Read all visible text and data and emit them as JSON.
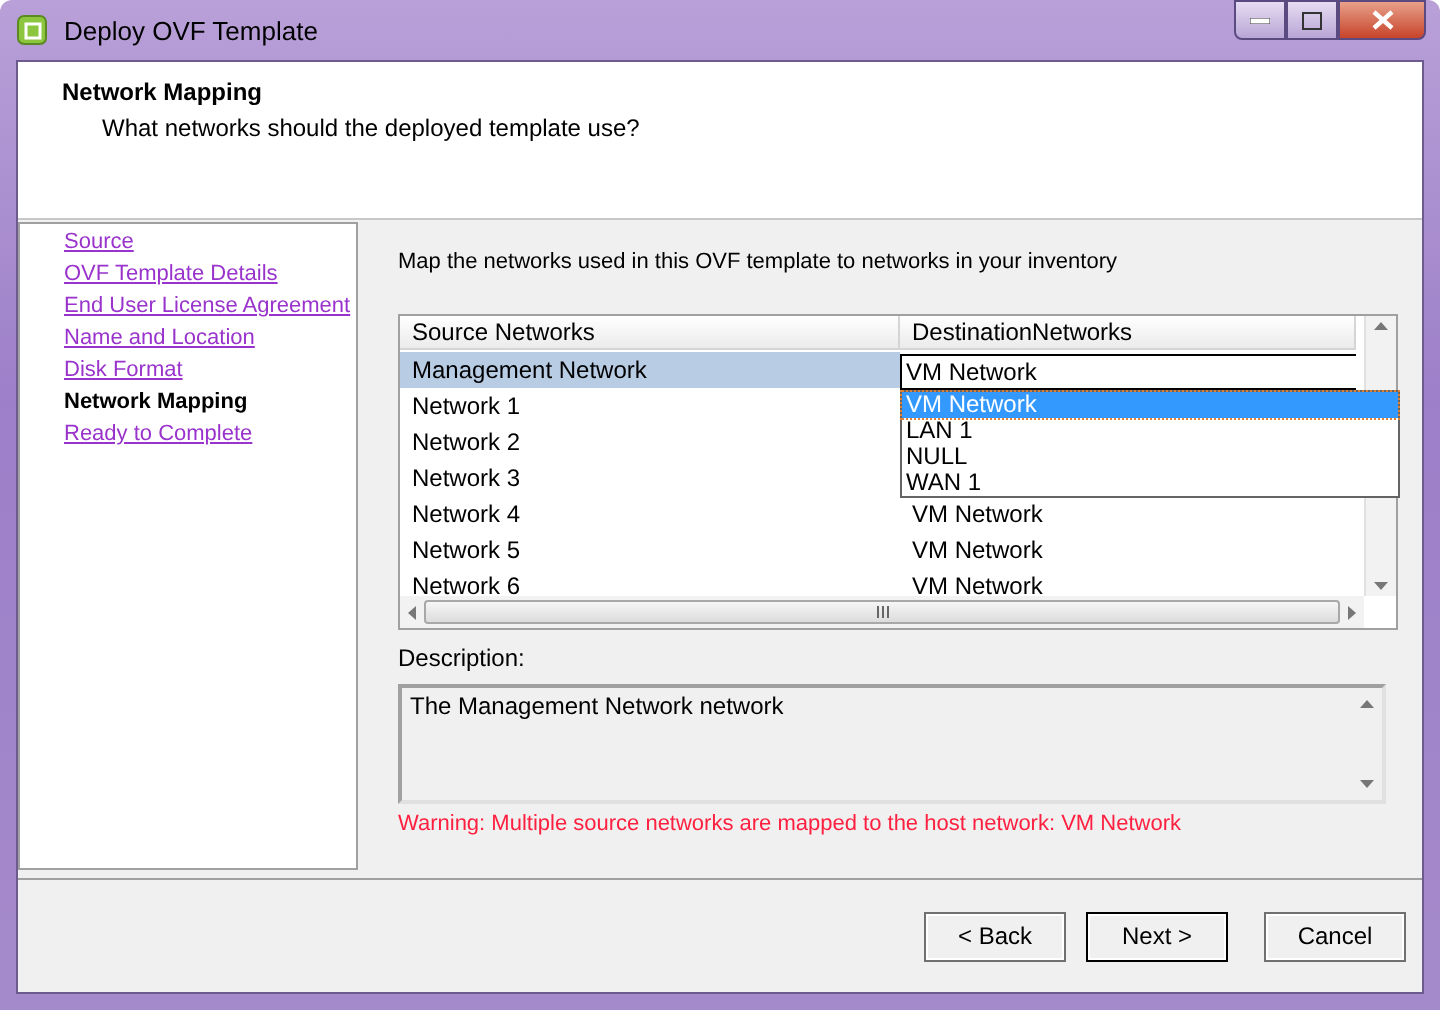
{
  "window": {
    "title": "Deploy OVF Template"
  },
  "header": {
    "title": "Network Mapping",
    "subtitle": "What networks should the deployed template use?"
  },
  "steps": [
    {
      "label": "Source",
      "selected": false
    },
    {
      "label": "OVF Template Details",
      "selected": false
    },
    {
      "label": "End User License Agreement",
      "selected": false
    },
    {
      "label": "Name and Location",
      "selected": false
    },
    {
      "label": "Disk Format",
      "selected": false
    },
    {
      "label": "Network Mapping",
      "selected": true
    },
    {
      "label": "Ready to Complete",
      "selected": false
    }
  ],
  "intro": "Map the networks used in this OVF template to networks in your inventory",
  "table": {
    "columns": [
      "Source Networks",
      "DestinationNetworks"
    ],
    "rows": [
      {
        "source": "Management Network",
        "destination": "VM Network",
        "selected": true
      },
      {
        "source": "Network 1",
        "selected": false
      },
      {
        "source": "Network 2",
        "selected": false
      },
      {
        "source": "Network 3",
        "selected": false
      },
      {
        "source": "Network 4",
        "destination": "VM Network",
        "selected": false
      },
      {
        "source": "Network 5",
        "destination": "VM Network",
        "selected": false
      },
      {
        "source": "Network 6",
        "destination": "VM Network",
        "selected": false
      }
    ],
    "dropdown": {
      "options": [
        {
          "label": "VM Network",
          "selected": true
        },
        {
          "label": "LAN 1",
          "selected": false
        },
        {
          "label": "NULL",
          "selected": false
        },
        {
          "label": "WAN 1",
          "selected": false
        }
      ]
    }
  },
  "description": {
    "label": "Description:",
    "text": "The Management Network network"
  },
  "warning": "Warning: Multiple source networks are mapped to the host network: VM Network",
  "buttons": [
    "< Back",
    "Next >",
    "Cancel"
  ]
}
